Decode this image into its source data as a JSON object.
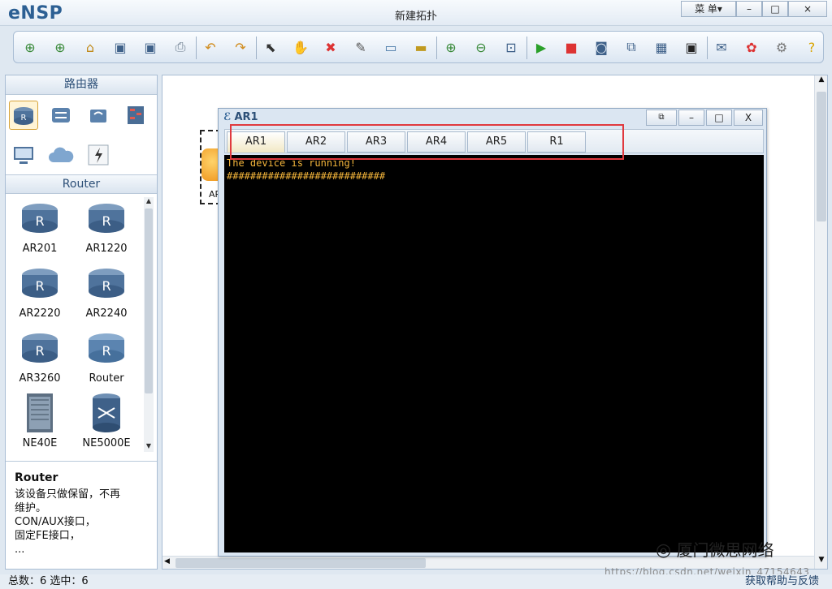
{
  "app": {
    "logo": "eNSP",
    "title": "新建拓扑",
    "menu_label": "菜 单▾",
    "window_buttons": [
      "–",
      "□",
      "×"
    ]
  },
  "toolbar": {
    "items": [
      {
        "name": "new-topology-icon",
        "glyph": "⊕"
      },
      {
        "name": "new-lab-icon",
        "glyph": "⊕"
      },
      {
        "name": "open-icon",
        "glyph": "⌂"
      },
      {
        "name": "save-icon",
        "glyph": "▣"
      },
      {
        "name": "save-as-icon",
        "glyph": "▣"
      },
      {
        "name": "print-icon",
        "glyph": "⎙"
      },
      {
        "name": "undo-icon",
        "glyph": "↶"
      },
      {
        "name": "redo-icon",
        "glyph": "↷"
      },
      {
        "name": "select-icon",
        "glyph": "⬉"
      },
      {
        "name": "hand-icon",
        "glyph": "✋"
      },
      {
        "name": "delete-icon",
        "glyph": "✖"
      },
      {
        "name": "delete-link-icon",
        "glyph": "✎"
      },
      {
        "name": "text-icon",
        "glyph": "▭"
      },
      {
        "name": "rectangle-icon",
        "glyph": "▬"
      },
      {
        "name": "zoom-in-icon",
        "glyph": "⊕"
      },
      {
        "name": "zoom-out-icon",
        "glyph": "⊖"
      },
      {
        "name": "fit-icon",
        "glyph": "⊡"
      },
      {
        "name": "start-icon",
        "glyph": "▶"
      },
      {
        "name": "stop-icon",
        "glyph": "■"
      },
      {
        "name": "capture-icon",
        "glyph": "◙"
      },
      {
        "name": "topology-icon",
        "glyph": "⧉"
      },
      {
        "name": "grid-icon",
        "glyph": "▦"
      },
      {
        "name": "screenshot-icon",
        "glyph": "▣"
      },
      {
        "name": "comment-icon",
        "glyph": "✉"
      },
      {
        "name": "huawei-icon",
        "glyph": "✿"
      },
      {
        "name": "settings-icon",
        "glyph": "⚙"
      },
      {
        "name": "help-icon",
        "glyph": "?"
      }
    ]
  },
  "left_panel": {
    "category_header": "路由器",
    "devices_header": "Router",
    "devices": [
      {
        "label": "AR201"
      },
      {
        "label": "AR1220"
      },
      {
        "label": "AR2220"
      },
      {
        "label": "AR2240"
      },
      {
        "label": "AR3260"
      },
      {
        "label": "Router"
      },
      {
        "label": "NE40E"
      },
      {
        "label": "NE5000E"
      }
    ],
    "description": {
      "title": "Router",
      "lines": [
        "该设备只做保留，不再",
        "维护。",
        "CON/AUX接口，",
        "固定FE接口，",
        "..."
      ]
    }
  },
  "canvas": {
    "device_label_partial": "AR"
  },
  "terminal": {
    "title": "AR1",
    "tabs": [
      "AR1",
      "AR2",
      "AR3",
      "AR4",
      "AR5",
      "R1"
    ],
    "active_tab": "AR1",
    "lines": [
      "The device is running!",
      "###########################"
    ]
  },
  "status": {
    "left": "总数：6 选中：6",
    "right": "获取帮助与反馈"
  },
  "watermark": {
    "text": "厦门微思网络",
    "url": "https://blog.csdn.net/weixin_47154643"
  },
  "colors": {
    "console_text": "#f5b63b",
    "highlight": "#e0393e",
    "accent": "#2c5f93"
  }
}
